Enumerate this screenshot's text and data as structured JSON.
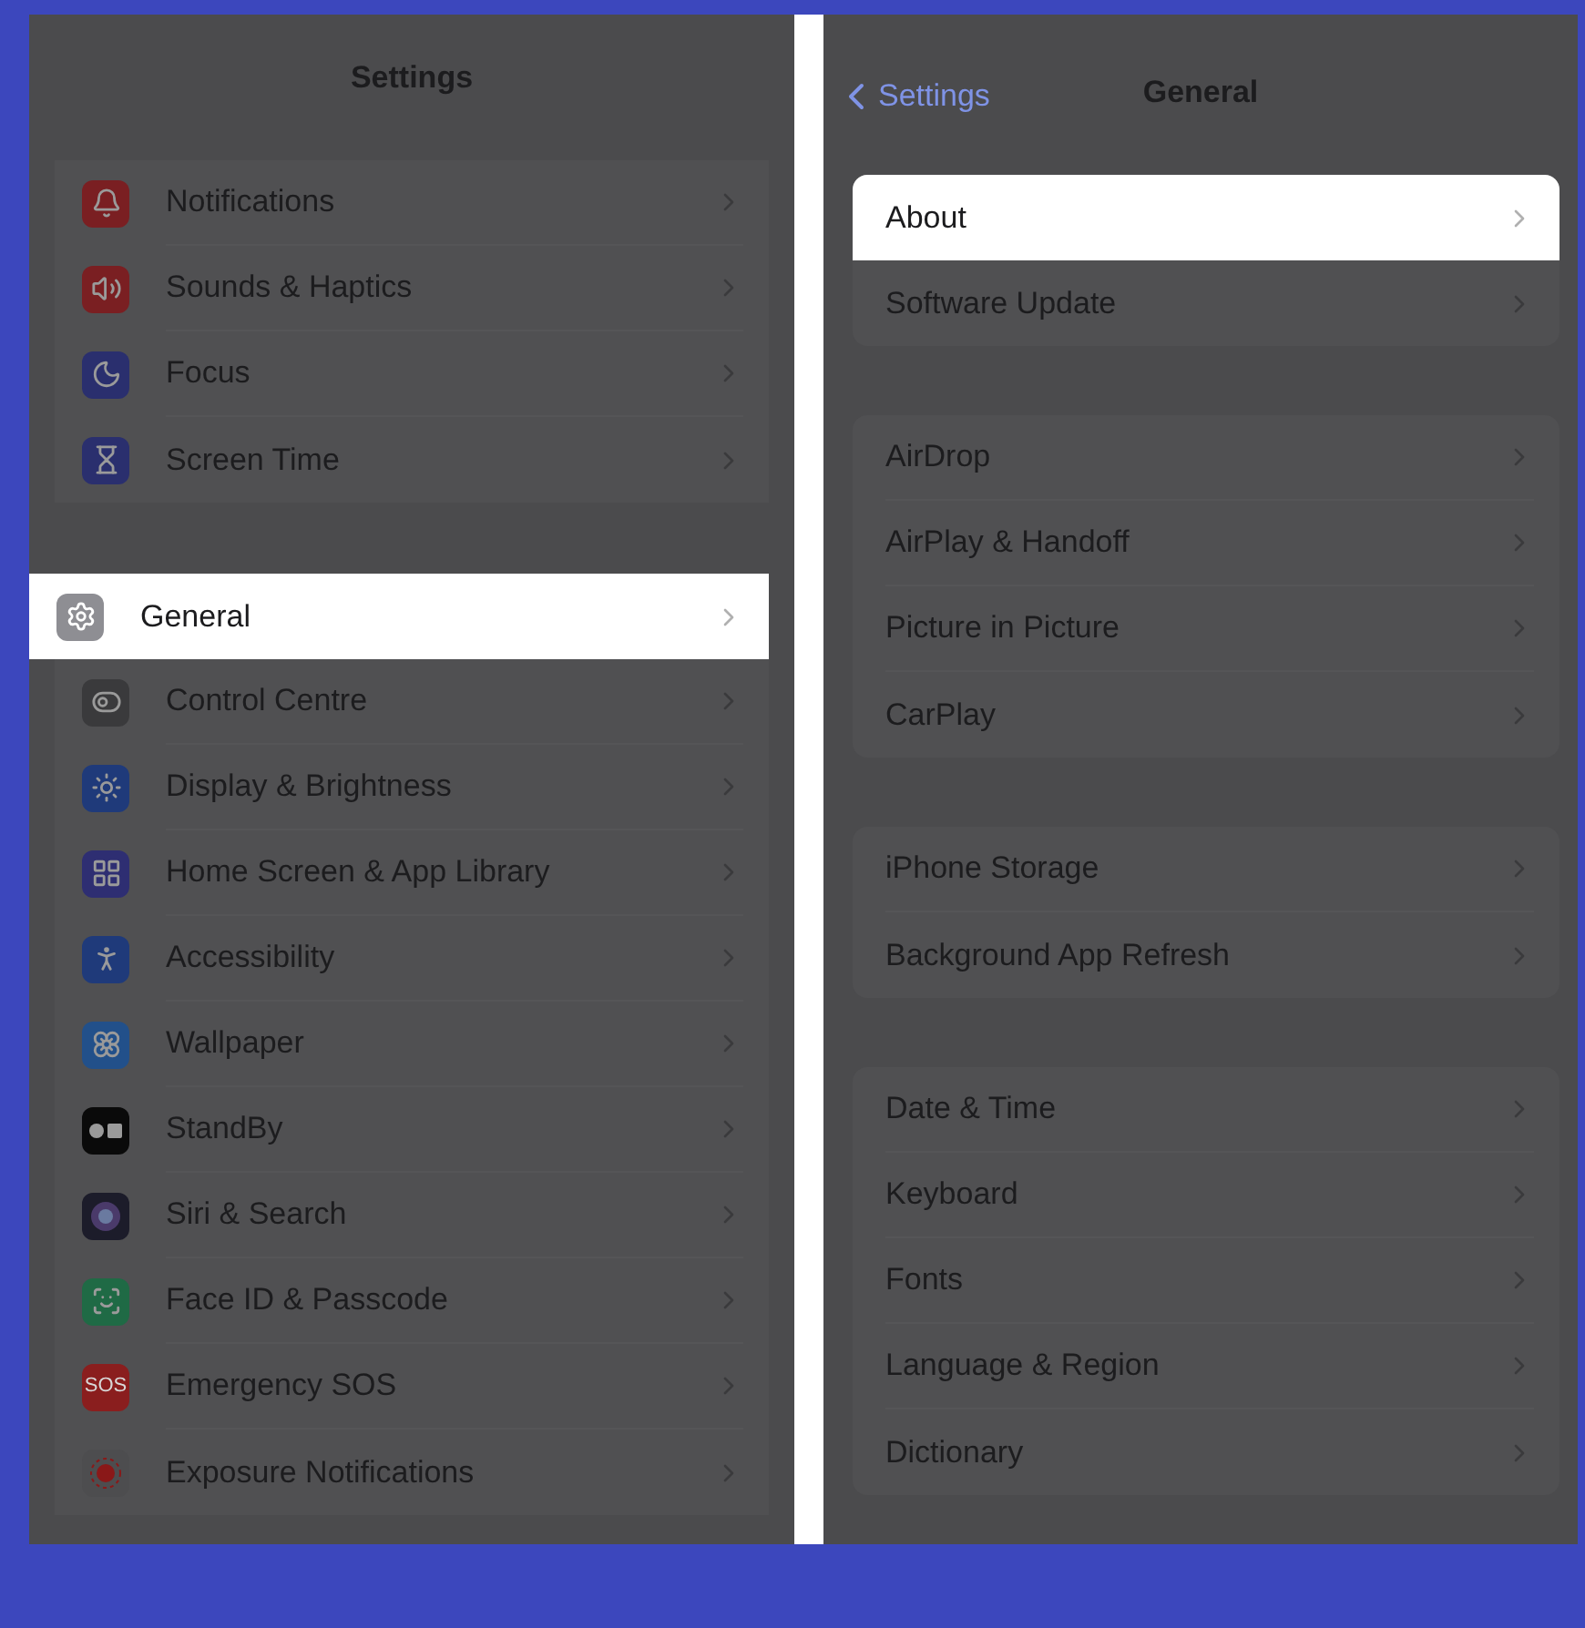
{
  "left": {
    "title": "Settings",
    "groups": [
      [
        {
          "label": "Notifications",
          "color": "#7a1f22",
          "selected": false
        },
        {
          "label": "Sounds & Haptics",
          "color": "#7a1f22",
          "selected": false
        },
        {
          "label": "Focus",
          "color": "#2a2f6e",
          "selected": false
        },
        {
          "label": "Screen Time",
          "color": "#2a2f6e",
          "selected": false
        }
      ],
      [
        {
          "label": "General",
          "color": "#8e8e93",
          "selected": true
        },
        {
          "label": "Control Centre",
          "color": "#3a3a3c",
          "selected": false
        },
        {
          "label": "Display & Brightness",
          "color": "#1f3a7a",
          "selected": false
        },
        {
          "label": "Home Screen & App Library",
          "color": "#2e2e72",
          "selected": false
        },
        {
          "label": "Accessibility",
          "color": "#1f3a7a",
          "selected": false
        },
        {
          "label": "Wallpaper",
          "color": "#22508a",
          "selected": false
        },
        {
          "label": "StandBy",
          "color": "#0a0a0a",
          "selected": false
        },
        {
          "label": "Siri & Search",
          "color": "#1c1c2a",
          "selected": false
        },
        {
          "label": "Face ID & Passcode",
          "color": "#1f6a45",
          "selected": false
        },
        {
          "label": "Emergency SOS",
          "icon_text": "SOS",
          "color": "#8a1e1e",
          "selected": false
        },
        {
          "label": "Exposure Notifications",
          "color": "#4d4d4f",
          "selected": false
        }
      ]
    ]
  },
  "right": {
    "back": "Settings",
    "title": "General",
    "groups": [
      [
        {
          "label": "About",
          "selected": true
        },
        {
          "label": "Software Update",
          "selected": false
        }
      ],
      [
        {
          "label": "AirDrop",
          "selected": false
        },
        {
          "label": "AirPlay & Handoff",
          "selected": false
        },
        {
          "label": "Picture in Picture",
          "selected": false
        },
        {
          "label": "CarPlay",
          "selected": false
        }
      ],
      [
        {
          "label": "iPhone Storage",
          "selected": false
        },
        {
          "label": "Background App Refresh",
          "selected": false
        }
      ],
      [
        {
          "label": "Date & Time",
          "selected": false
        },
        {
          "label": "Keyboard",
          "selected": false
        },
        {
          "label": "Fonts",
          "selected": false
        },
        {
          "label": "Language & Region",
          "selected": false
        },
        {
          "label": "Dictionary",
          "selected": false
        }
      ]
    ]
  }
}
